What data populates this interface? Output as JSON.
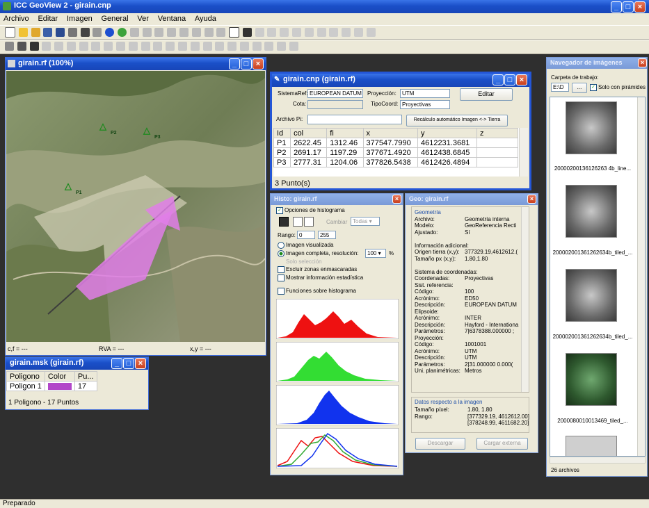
{
  "app": {
    "title": "ICC GeoView 2 - girain.cnp",
    "status": "Preparado"
  },
  "menu": [
    "Archivo",
    "Editar",
    "Imagen",
    "General",
    "Ver",
    "Ventana",
    "Ayuda"
  ],
  "map_window": {
    "title": "girain.rf (100%)",
    "status": {
      "cf": "c,f = ---",
      "rva": "RVA = ---",
      "xy": "x,y = ---"
    },
    "points": [
      "P1",
      "P2",
      "P3"
    ]
  },
  "cnp_window": {
    "title": "girain.cnp (girain.rf)",
    "sistema_ref_label": "SistemaRef:",
    "sistema_ref_value": "EUROPEAN DATUM",
    "proyeccion_label": "Proyección:",
    "proyeccion_value": "UTM",
    "editar_label": "Editar",
    "cota_label": "Cota:",
    "tipocoord_label": "TipoCoord:",
    "tipocoord_value": "Proyectivas",
    "archivo_label": "Archivo Pi:",
    "recalc_label": "Recálculo automático Imagen <-> Tierra",
    "columns": [
      "Id",
      "col",
      "fi",
      "x",
      "y",
      "z"
    ],
    "rows": [
      [
        "P1",
        "2622.45",
        "1312.46",
        "377547.7990",
        "4612231.3681",
        ""
      ],
      [
        "P2",
        "2691.17",
        "1197.29",
        "377671.4920",
        "4612438.6845",
        ""
      ],
      [
        "P3",
        "2777.31",
        "1204.06",
        "377826.5438",
        "4612426.4894",
        ""
      ]
    ],
    "footer": "3 Punto(s)"
  },
  "msk_window": {
    "title": "girain.msk (girain.rf)",
    "columns": [
      "Poligono",
      "Color",
      "Pu..."
    ],
    "rows": [
      [
        "Poligon 1",
        "",
        "17"
      ]
    ],
    "swatch_color": "#b247c9",
    "footer": "1 Poligono - 17 Puntos"
  },
  "histo_window": {
    "title": "Histo: girain.rf",
    "opciones_label": "Opciones de histograma",
    "cambiar_label": "Cambiar",
    "todas_label": "Todas",
    "rango_label": "Rango:",
    "rango_min": "0",
    "rango_max": "255",
    "radio1": "Imagen visualizada",
    "radio2": "Imagen completa, resolución:",
    "resolucion": "100",
    "percent": "%",
    "solo_label": "Solo selección",
    "excluir_label": "Excluir zonas enmascaradas",
    "mostrar_label": "Mostrar información estadística",
    "funciones_label": "Funciones sobre histograma",
    "colors": {
      "red": "#ee1111",
      "green": "#33dd33",
      "blue": "#1133ee"
    }
  },
  "geo_window": {
    "title": "Geo: girain.rf",
    "lines": [
      [
        "Geometría",
        ""
      ],
      [
        "Archivo:",
        "Geometría interna"
      ],
      [
        "Modelo:",
        "GeoReferencia Recti"
      ],
      [
        "Ajustado:",
        "Sí"
      ],
      [
        "",
        ""
      ],
      [
        "Información adicional:",
        ""
      ],
      [
        "  Origen tierra (x,y):",
        "377329.19,4612612.("
      ],
      [
        "  Tamaño px (x,y):",
        "1.80,1.80"
      ],
      [
        "",
        ""
      ],
      [
        "Sistema de coordenadas:",
        ""
      ],
      [
        "  Coordenadas:",
        "Proyectivas"
      ],
      [
        "  Sist. referencia:",
        ""
      ],
      [
        "    Código:",
        "100"
      ],
      [
        "    Acrónimo:",
        "ED50"
      ],
      [
        "    Descripción:",
        "EUROPEAN DATUM"
      ],
      [
        "  Elipsoide:",
        ""
      ],
      [
        "    Acrónimo:",
        "INTER"
      ],
      [
        "    Descripción:",
        "Hayford - Internationa"
      ],
      [
        "    Parámetros:",
        "7|6378388.000000 ;"
      ],
      [
        "  Proyección:",
        ""
      ],
      [
        "    Código:",
        "1001001"
      ],
      [
        "    Acrónimo:",
        "UTM"
      ],
      [
        "    Descripción:",
        "UTM"
      ],
      [
        "    Parámetros:",
        "2|31.000000 0.000("
      ],
      [
        "  Uni. planimétricas:",
        "Metros"
      ]
    ],
    "datos_title": "Datos respecto a la imagen",
    "tamano_label": "Tamaño píxel:",
    "tamano_value": "1.80, 1.80",
    "rango_label": "Rango:",
    "rango_value1": "[377329.19, 4612612.00]",
    "rango_value2": "[378248.99, 4611682.20]",
    "descargar_label": "Descargar",
    "cargar_label": "Cargar externa"
  },
  "nav_window": {
    "title": "Navegador de imágenes",
    "carpeta_label": "Carpeta de trabajo:",
    "drive": "E:\\D",
    "browse": "...",
    "solo_label": "Solo con pirámides",
    "thumbs": [
      "20000200136126263 4b_line...",
      "200002001361262634b_tiled_...",
      "200002001361262634b_tiled_...",
      "2000080010013469_tiled_..."
    ],
    "footer": "26 archivos"
  }
}
